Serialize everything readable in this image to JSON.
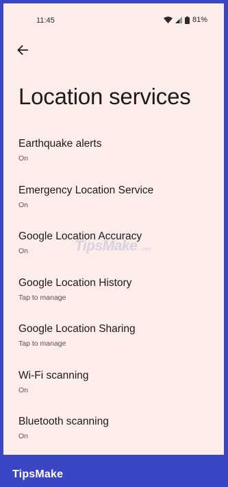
{
  "status_bar": {
    "time": "11:45",
    "battery": "81%",
    "icons": [
      "wifi-icon",
      "signal-icon",
      "battery-icon"
    ]
  },
  "header": {
    "back_icon": "arrow-left-icon",
    "title": "Location services"
  },
  "items": [
    {
      "title": "Earthquake alerts",
      "summary": "On"
    },
    {
      "title": "Emergency Location Service",
      "summary": "On"
    },
    {
      "title": "Google Location Accuracy",
      "summary": "On"
    },
    {
      "title": "Google Location History",
      "summary": "Tap to manage"
    },
    {
      "title": "Google Location Sharing",
      "summary": "Tap to manage"
    },
    {
      "title": "Wi-Fi scanning",
      "summary": "On"
    },
    {
      "title": "Bluetooth scanning",
      "summary": "On"
    }
  ],
  "watermark": {
    "text": "TipsMake",
    "suffix": ".com"
  },
  "brand": {
    "name": "TipsMake"
  },
  "colors": {
    "frame": "#3a46c3",
    "background": "#fcecea",
    "text_primary": "#1e1a1a",
    "text_secondary": "#5a5250"
  }
}
